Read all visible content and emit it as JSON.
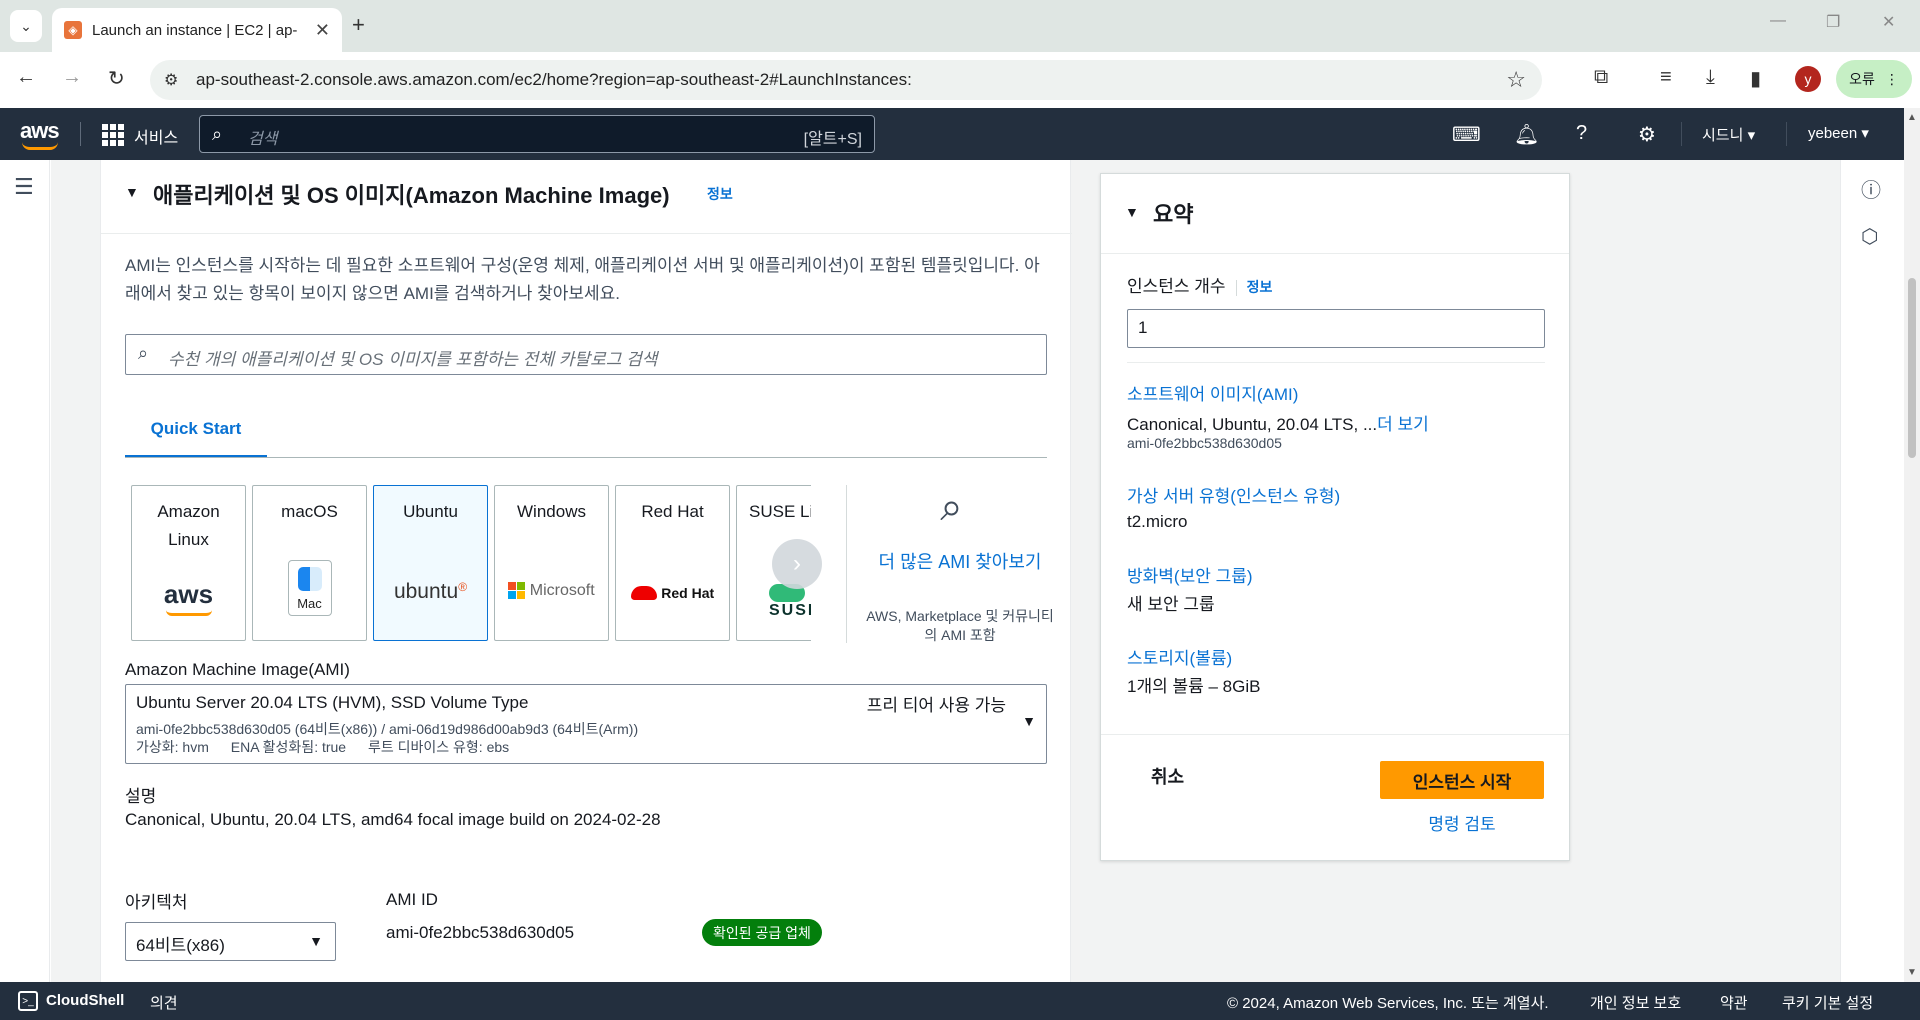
{
  "browser": {
    "tab_title": "Launch an instance | EC2 | ap-",
    "url": "ap-southeast-2.console.aws.amazon.com/ec2/home?region=ap-southeast-2#LaunchInstances:",
    "profile_initial": "y",
    "error_label": "오류"
  },
  "aws_nav": {
    "logo": "aws",
    "services": "서비스",
    "search_placeholder": "검색",
    "search_shortcut": "[알트+S]",
    "region": "시드니",
    "user": "yebeen"
  },
  "ami_section": {
    "title": "애플리케이션 및 OS 이미지(Amazon Machine Image)",
    "info": "정보",
    "description": "AMI는 인스턴스를 시작하는 데 필요한 소프트웨어 구성(운영 체제, 애플리케이션 서버 및 애플리케이션)이 포함된 템플릿입니다. 아래에서 찾고 있는 항목이 보이지 않으면 AMI를 검색하거나 찾아보세요.",
    "catalog_search_placeholder": "수천 개의 애플리케이션 및 OS 이미지를 포함하는 전체 카탈로그 검색",
    "tab": "Quick Start",
    "os_options": [
      {
        "name": "Amazon Linux",
        "logo": "aws",
        "selected": false
      },
      {
        "name": "macOS",
        "logo": "Mac",
        "selected": false
      },
      {
        "name": "Ubuntu",
        "logo": "ubuntu",
        "selected": true
      },
      {
        "name": "Windows",
        "logo": "Microsoft",
        "selected": false
      },
      {
        "name": "Red Hat",
        "logo": "Red Hat",
        "selected": false
      },
      {
        "name": "SUSE Li",
        "logo": "SUSE",
        "selected": false
      }
    ],
    "more_ami_title": "더 많은 AMI 찾아보기",
    "more_ami_sub": "AWS, Marketplace 및 커뮤니티의 AMI 포함",
    "ami_label": "Amazon Machine Image(AMI)",
    "ami_name": "Ubuntu Server 20.04 LTS (HVM), SSD Volume Type",
    "ami_ids": "ami-0fe2bbc538d630d05 (64비트(x86)) / ami-06d19d986d00ab9d3 (64비트(Arm))",
    "ami_virt": "가상화: hvm",
    "ami_ena": "ENA 활성화됨: true",
    "ami_root": "루트 디바이스 유형: ebs",
    "free_tier": "프리 티어 사용 가능",
    "desc_label": "설명",
    "desc_value": "Canonical, Ubuntu, 20.04 LTS, amd64 focal image build on 2024-02-28",
    "arch_label": "아키텍처",
    "arch_value": "64비트(x86)",
    "ami_id_label": "AMI ID",
    "ami_id_value": "ami-0fe2bbc538d630d05",
    "verified_badge": "확인된 공급 업체"
  },
  "summary": {
    "title": "요약",
    "instance_count_label": "인스턴스 개수",
    "info": "정보",
    "instance_count": "1",
    "software_image_link": "소프트웨어 이미지(AMI)",
    "software_image_value": "Canonical, Ubuntu, 20.04 LTS, ...",
    "more": "더 보기",
    "software_image_id": "ami-0fe2bbc538d630d05",
    "instance_type_link": "가상 서버 유형(인스턴스 유형)",
    "instance_type_value": "t2.micro",
    "firewall_link": "방화벽(보안 그룹)",
    "firewall_value": "새 보안 그룹",
    "storage_link": "스토리지(볼륨)",
    "storage_value": "1개의 볼륨 – 8GiB",
    "cancel": "취소",
    "launch": "인스턴스 시작",
    "review": "명령 검토"
  },
  "footer": {
    "cloudshell": "CloudShell",
    "feedback": "의견",
    "copyright": "© 2024, Amazon Web Services, Inc. 또는 계열사.",
    "privacy": "개인 정보 보호",
    "terms": "약관",
    "cookies": "쿠키 기본 설정"
  },
  "colors": {
    "aws_nav_bg": "#232f3e",
    "link": "#0972d3",
    "primary_button": "#ff9900",
    "badge": "#037f0c"
  }
}
